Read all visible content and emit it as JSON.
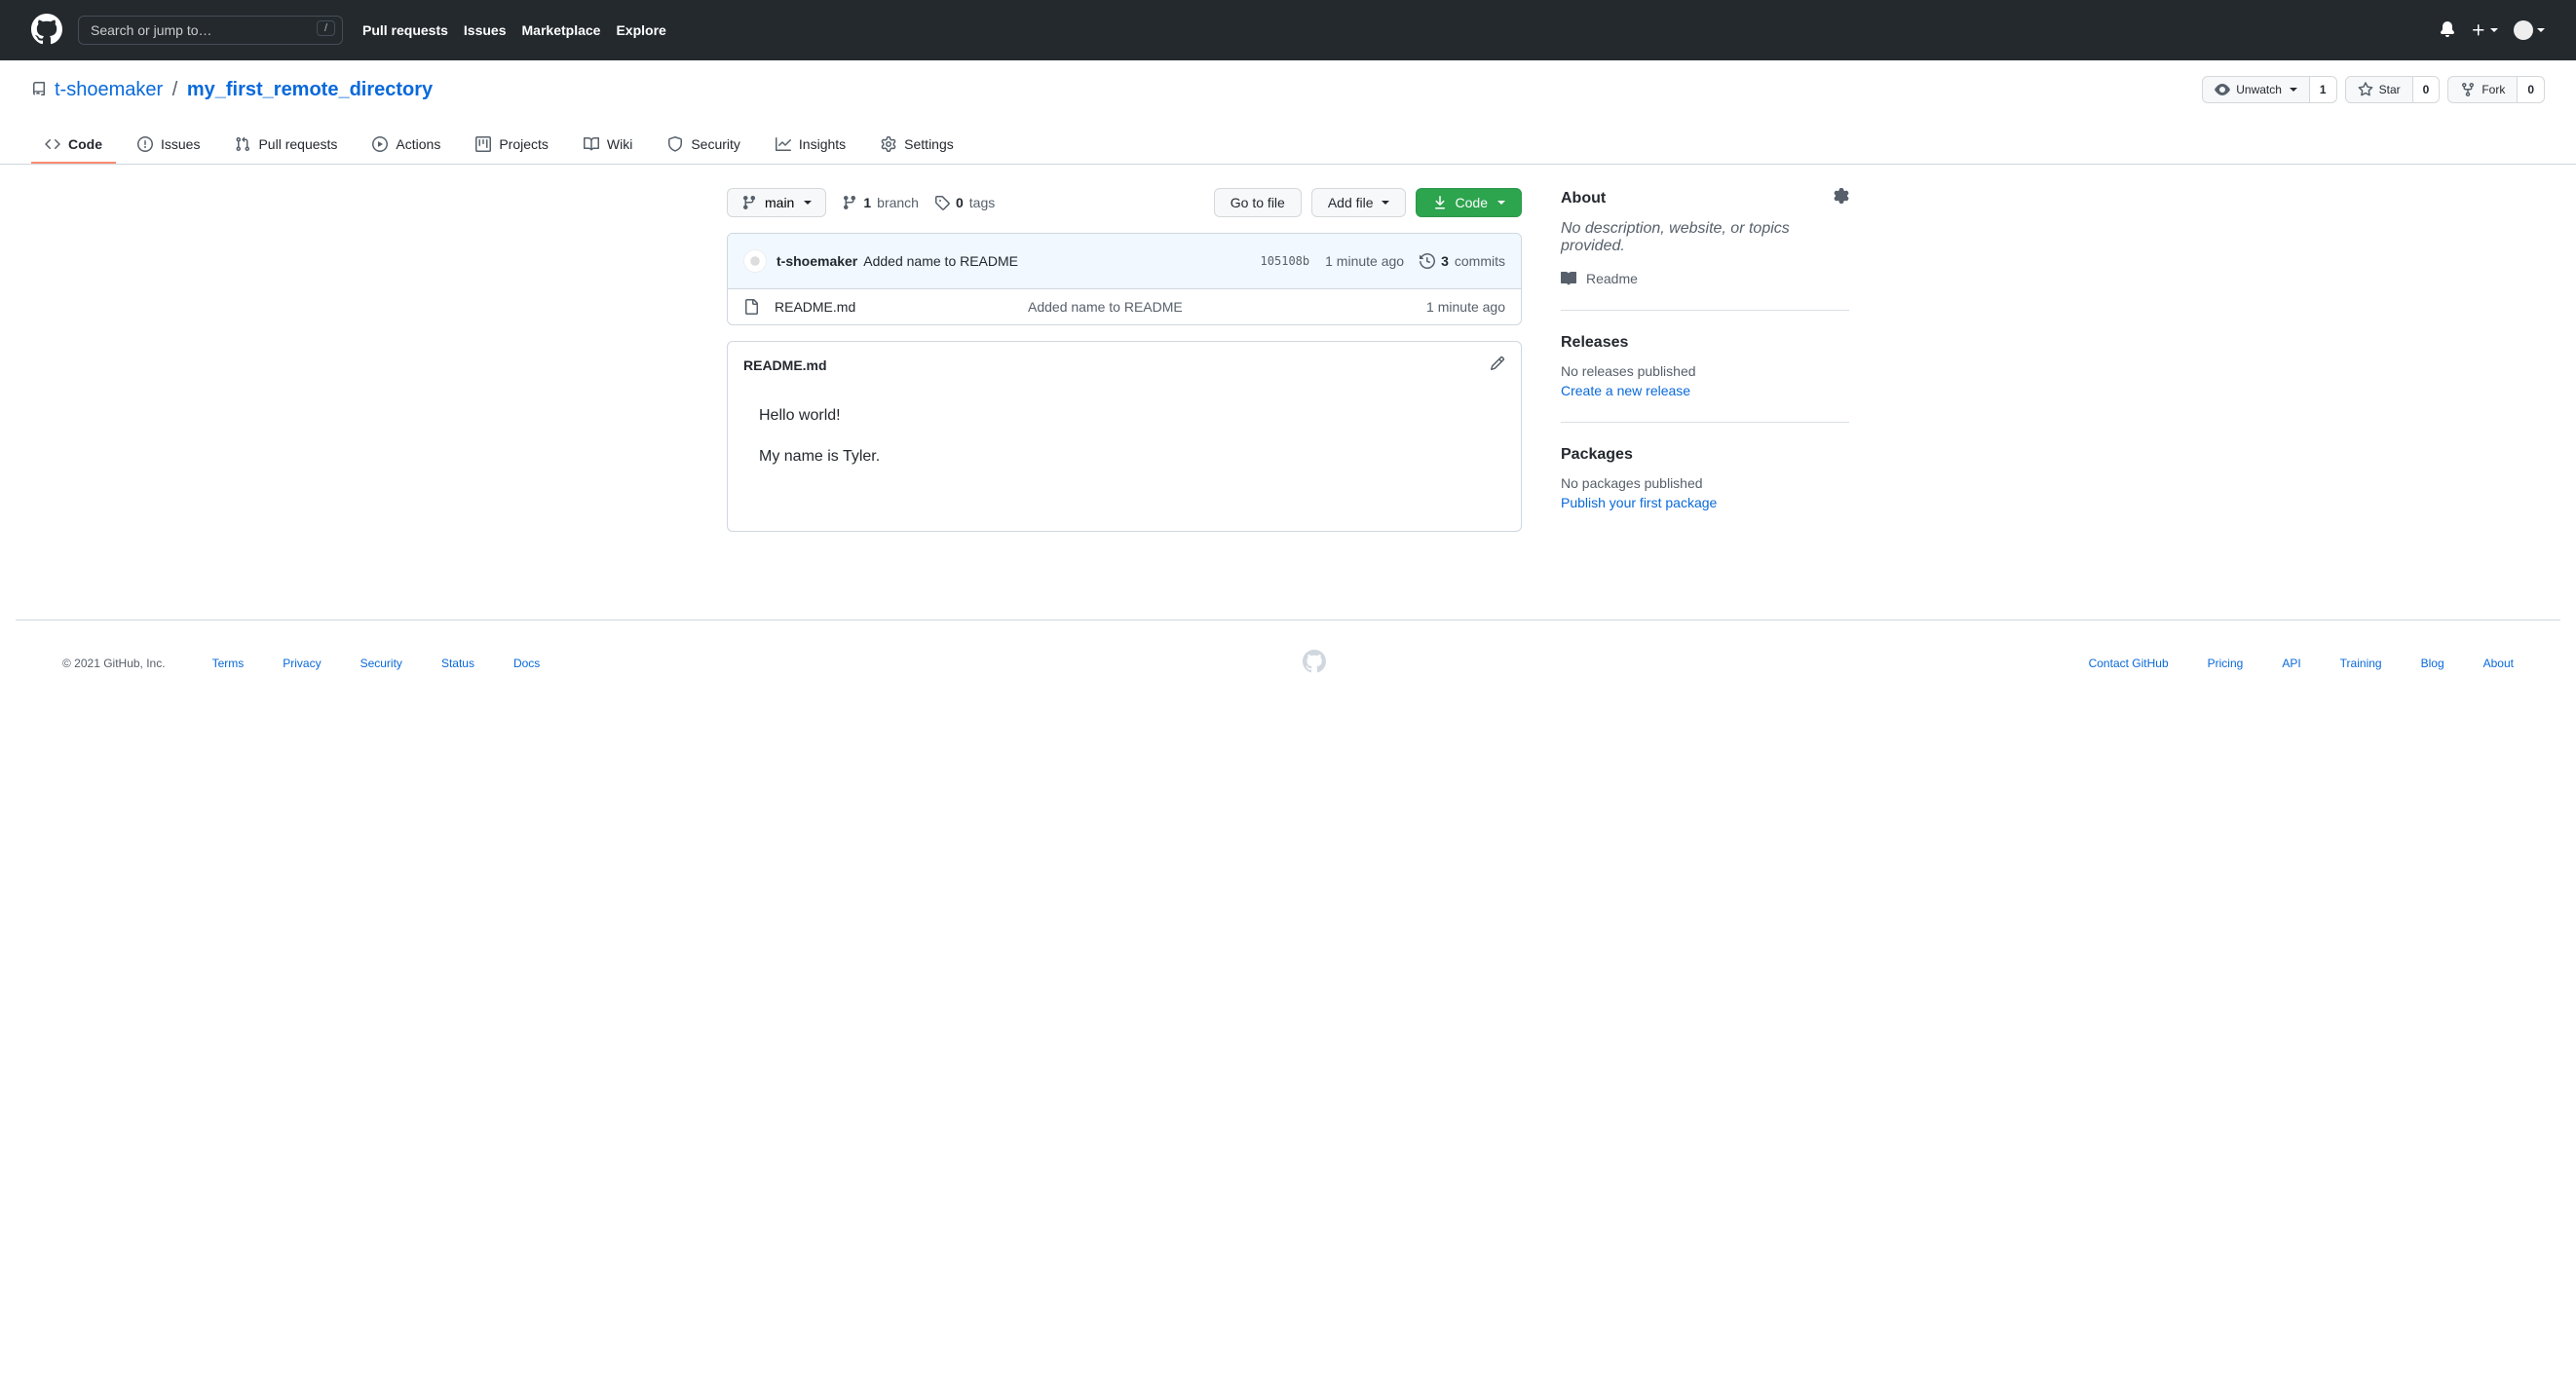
{
  "header": {
    "search_placeholder": "Search or jump to…",
    "slash": "/",
    "nav": {
      "pulls": "Pull requests",
      "issues": "Issues",
      "marketplace": "Marketplace",
      "explore": "Explore"
    }
  },
  "repo": {
    "owner": "t-shoemaker",
    "name": "my_first_remote_directory",
    "sep": "/",
    "actions": {
      "watch": {
        "label": "Unwatch",
        "count": "1"
      },
      "star": {
        "label": "Star",
        "count": "0"
      },
      "fork": {
        "label": "Fork",
        "count": "0"
      }
    }
  },
  "tabs": {
    "code": "Code",
    "issues": "Issues",
    "pulls": "Pull requests",
    "actions": "Actions",
    "projects": "Projects",
    "wiki": "Wiki",
    "security": "Security",
    "insights": "Insights",
    "settings": "Settings"
  },
  "filenav": {
    "branch": "main",
    "branches_count": "1",
    "branches_word": "branch",
    "tags_count": "0",
    "tags_word": "tags",
    "go_to_file": "Go to file",
    "add_file": "Add file",
    "code_btn": "Code"
  },
  "commit": {
    "author": "t-shoemaker",
    "message": "Added name to README",
    "sha": "105108b",
    "time": "1 minute ago",
    "commits_count": "3",
    "commits_word": "commits"
  },
  "files": [
    {
      "name": "README.md",
      "message": "Added name to README",
      "time": "1 minute ago"
    }
  ],
  "readme": {
    "filename": "README.md",
    "line1": "Hello world!",
    "line2": "My name is Tyler."
  },
  "sidebar": {
    "about_title": "About",
    "about_desc": "No description, website, or topics provided.",
    "readme_link": "Readme",
    "releases_title": "Releases",
    "releases_text": "No releases published",
    "releases_action": "Create a new release",
    "packages_title": "Packages",
    "packages_text": "No packages published",
    "packages_action": "Publish your first package"
  },
  "footer": {
    "copy": "© 2021 GitHub, Inc.",
    "left": {
      "terms": "Terms",
      "privacy": "Privacy",
      "security": "Security",
      "status": "Status",
      "docs": "Docs"
    },
    "right": {
      "contact": "Contact GitHub",
      "pricing": "Pricing",
      "api": "API",
      "training": "Training",
      "blog": "Blog",
      "about": "About"
    }
  }
}
